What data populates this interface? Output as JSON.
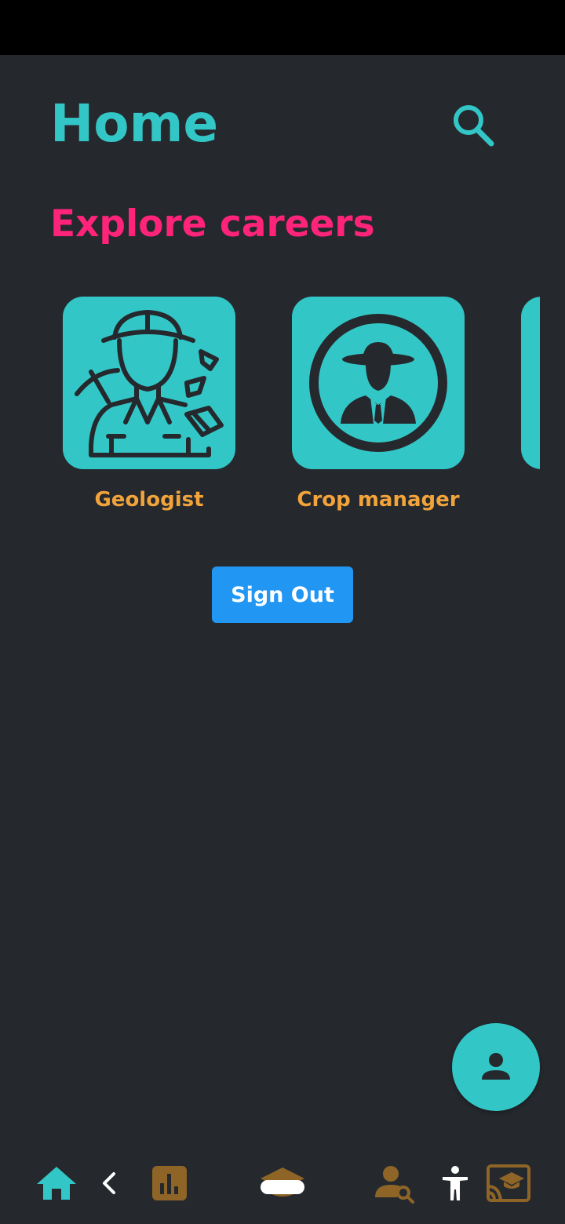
{
  "header": {
    "title": "Home",
    "search_icon": "search-icon"
  },
  "section": {
    "title": "Explore careers"
  },
  "careers": [
    {
      "label": "Geologist",
      "icon": "geologist-icon"
    },
    {
      "label": "Crop manager",
      "icon": "crop-manager-icon"
    }
  ],
  "sign_out": {
    "label": "Sign Out"
  },
  "fab": {
    "icon": "person-icon"
  },
  "bottom_nav": {
    "items": [
      {
        "icon": "home-icon"
      },
      {
        "icon": "back-chevron-icon"
      },
      {
        "icon": "bar-chart-icon"
      },
      {
        "icon": "graduation-cap-icon"
      },
      {
        "icon": "person-search-icon"
      },
      {
        "icon": "accessibility-icon"
      },
      {
        "icon": "cast-education-icon"
      }
    ]
  },
  "colors": {
    "background": "#25292e",
    "accent_teal": "#33c6c6",
    "accent_pink": "#ff2479",
    "label_orange": "#f2a33a",
    "button_blue": "#2196f3",
    "nav_brown": "#8e6526"
  }
}
